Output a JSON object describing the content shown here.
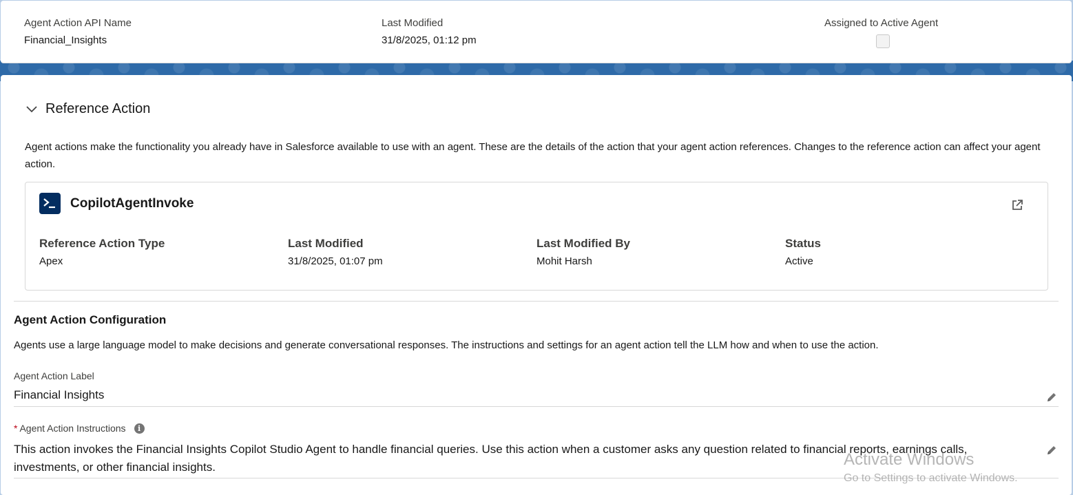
{
  "header": {
    "api_name_label": "Agent Action API Name",
    "api_name_value": "Financial_Insights",
    "last_modified_label": "Last Modified",
    "last_modified_value": "31/8/2025, 01:12 pm",
    "assigned_label": "Assigned to Active Agent",
    "assigned_checked": false
  },
  "reference_section": {
    "title": "Reference Action",
    "description": "Agent actions make the functionality you already have in Salesforce available to use with an agent. These are the details of the action that your agent action references. Changes to the reference action can affect your agent action.",
    "action_name": "CopilotAgentInvoke",
    "icon": "apex-prompt-icon",
    "fields": [
      {
        "label": "Reference Action Type",
        "value": "Apex"
      },
      {
        "label": "Last Modified",
        "value": "31/8/2025, 01:07 pm"
      },
      {
        "label": "Last Modified By",
        "value": "Mohit Harsh"
      },
      {
        "label": "Status",
        "value": "Active"
      }
    ]
  },
  "configuration": {
    "title": "Agent Action Configuration",
    "description": "Agents use a large language model to make decisions and generate conversational responses. The instructions and settings for an agent action tell the LLM how and when to use the action.",
    "label_field_label": "Agent Action Label",
    "label_field_value": "Financial Insights",
    "instructions_required_marker": "*",
    "instructions_label": "Agent Action Instructions",
    "instructions_value": "This action invokes the Financial Insights Copilot Studio Agent to handle financial queries. Use this action when a customer asks any question related to financial reports, earnings calls, investments, or other financial insights."
  },
  "watermark": {
    "line1": "Activate Windows",
    "line2": "Go to Settings to activate Windows."
  },
  "colors": {
    "brand_dark": "#032d60",
    "required": "#ba0517",
    "banner": "#2e6aa8"
  }
}
